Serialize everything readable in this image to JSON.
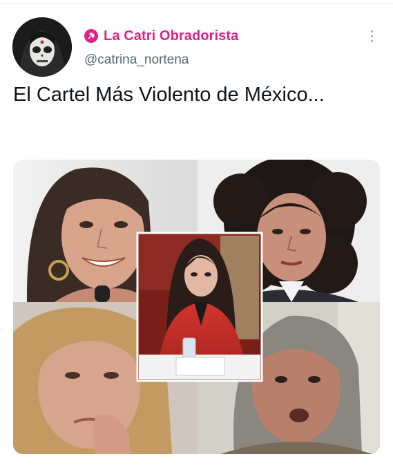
{
  "tweet": {
    "display_name": "La Catri Obradorista",
    "handle": "@catrina_nortena",
    "text": "El Cartel Más Violento de México...",
    "badge_icon": "pin-icon",
    "menu_icon": "more-options-icon"
  },
  "colors": {
    "name": "#e0218a",
    "handle": "#536471",
    "text": "#0f1419",
    "background": "#ffffff"
  },
  "media": {
    "layout": "collage",
    "panels": [
      "top-left-portrait",
      "top-right-portrait",
      "center-portrait",
      "bottom-left-portrait",
      "bottom-right-portrait"
    ]
  }
}
